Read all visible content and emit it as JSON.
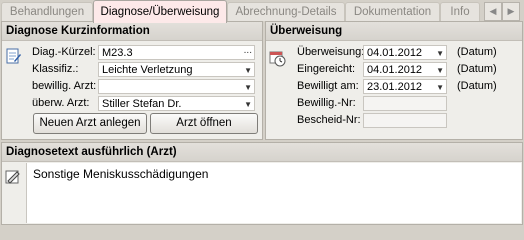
{
  "tabs": [
    {
      "label": "Behandlungen",
      "active": false
    },
    {
      "label": "Diagnose/Überweisung",
      "active": true
    },
    {
      "label": "Abrechnung-Details",
      "active": false
    },
    {
      "label": "Dokumentation",
      "active": false
    },
    {
      "label": "Info",
      "active": false
    }
  ],
  "tab_nav": {
    "prev": "◀",
    "next": "▶"
  },
  "diagnose": {
    "title": "Diagnose Kurzinformation",
    "diag_kuerzel_label": "Diag.-Kürzel:",
    "diag_kuerzel_value": "M23.3",
    "diag_kuerzel_button": "...",
    "klassifiz_label": "Klassifiz.:",
    "klassifiz_value": "Leichte Verletzung",
    "bewillig_label": "bewillig. Arzt:",
    "bewillig_value": "",
    "ueberw_label": "überw. Arzt:",
    "ueberw_value": "Stiller Stefan Dr.",
    "new_doctor_button": "Neuen Arzt anlegen",
    "open_doctor_button": "Arzt öffnen"
  },
  "ueberweisung": {
    "title": "Überweisung",
    "ueberweisung_label": "Überweisung:",
    "ueberweisung_date": "04.01.2012",
    "ueberweisung_hint": "(Datum)",
    "eingereicht_label": "Eingereicht:",
    "eingereicht_date": "04.01.2012",
    "eingereicht_hint": "(Datum)",
    "bewilligt_label": "Bewilligt am:",
    "bewilligt_date": "23.01.2012",
    "bewilligt_hint": "(Datum)",
    "bewillig_nr_label": "Bewillig.-Nr:",
    "bewillig_nr_value": "",
    "bescheid_nr_label": "Bescheid-Nr:",
    "bescheid_nr_value": ""
  },
  "diagnosetext": {
    "title": "Diagnosetext ausführlich (Arzt)",
    "text": "Sonstige Meniskusschädigungen"
  },
  "dropdown_glyph": "▼"
}
